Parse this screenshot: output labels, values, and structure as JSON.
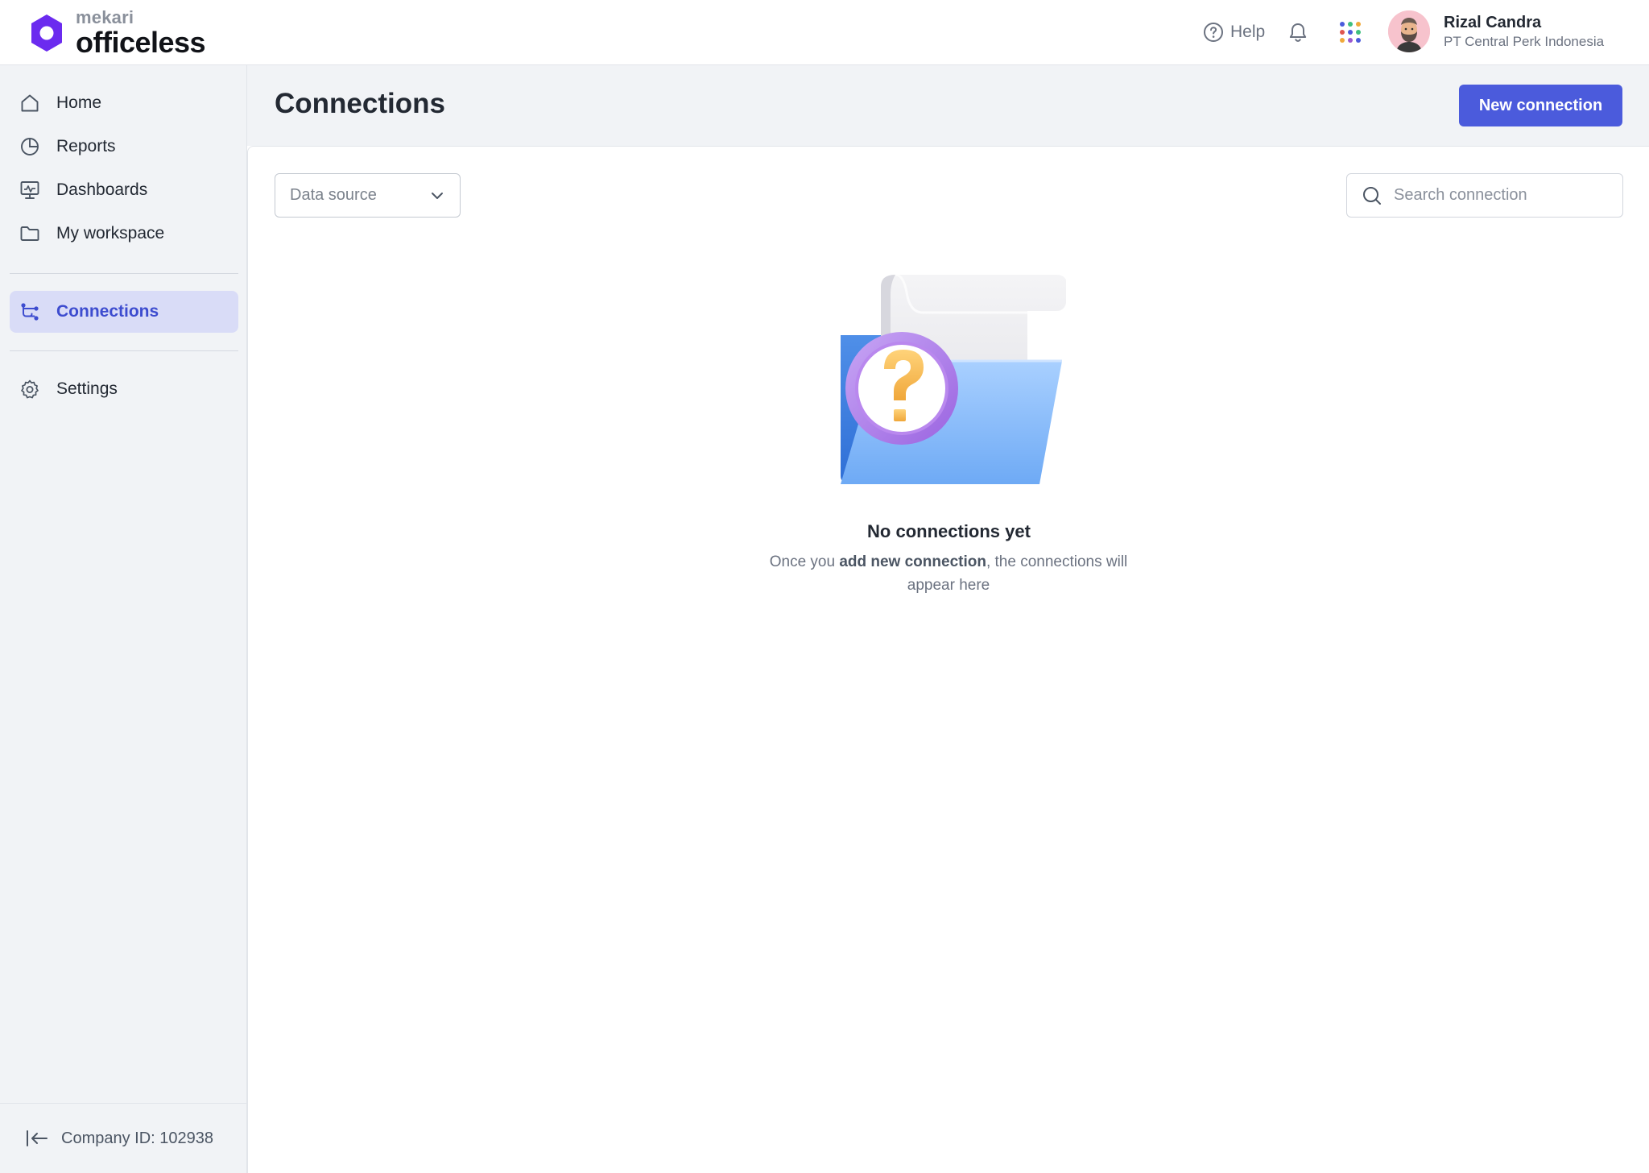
{
  "brand": {
    "sub": "mekari",
    "name": "officeless",
    "color": "#6b2bef"
  },
  "topbar": {
    "help_label": "Help",
    "user": {
      "name": "Rizal Candra",
      "company": "PT Central Perk Indonesia"
    },
    "icons": [
      "help-circle-icon",
      "bell-icon",
      "apps-grid-icon"
    ]
  },
  "sidebar": {
    "items": [
      {
        "label": "Home",
        "icon": "home-icon"
      },
      {
        "label": "Reports",
        "icon": "pie-chart-icon"
      },
      {
        "label": "Dashboards",
        "icon": "monitor-chart-icon"
      },
      {
        "label": "My workspace",
        "icon": "folder-icon"
      },
      {
        "label": "Connections",
        "icon": "connections-icon",
        "active": true
      },
      {
        "label": "Settings",
        "icon": "gear-icon"
      }
    ],
    "footer": "Company ID: 102938"
  },
  "page": {
    "title": "Connections",
    "new_button": "New connection",
    "filter": {
      "selected": "Data source"
    },
    "search": {
      "placeholder": "Search connection",
      "value": ""
    }
  },
  "empty_state": {
    "title": "No connections yet",
    "desc_prefix": "Once you ",
    "desc_bold": "add new connection",
    "desc_suffix": ", the connections will appear here"
  },
  "colors": {
    "accent": "#4b5bdc",
    "active_bg": "#d9dcf7",
    "sidebar_bg": "#f1f3f6"
  }
}
